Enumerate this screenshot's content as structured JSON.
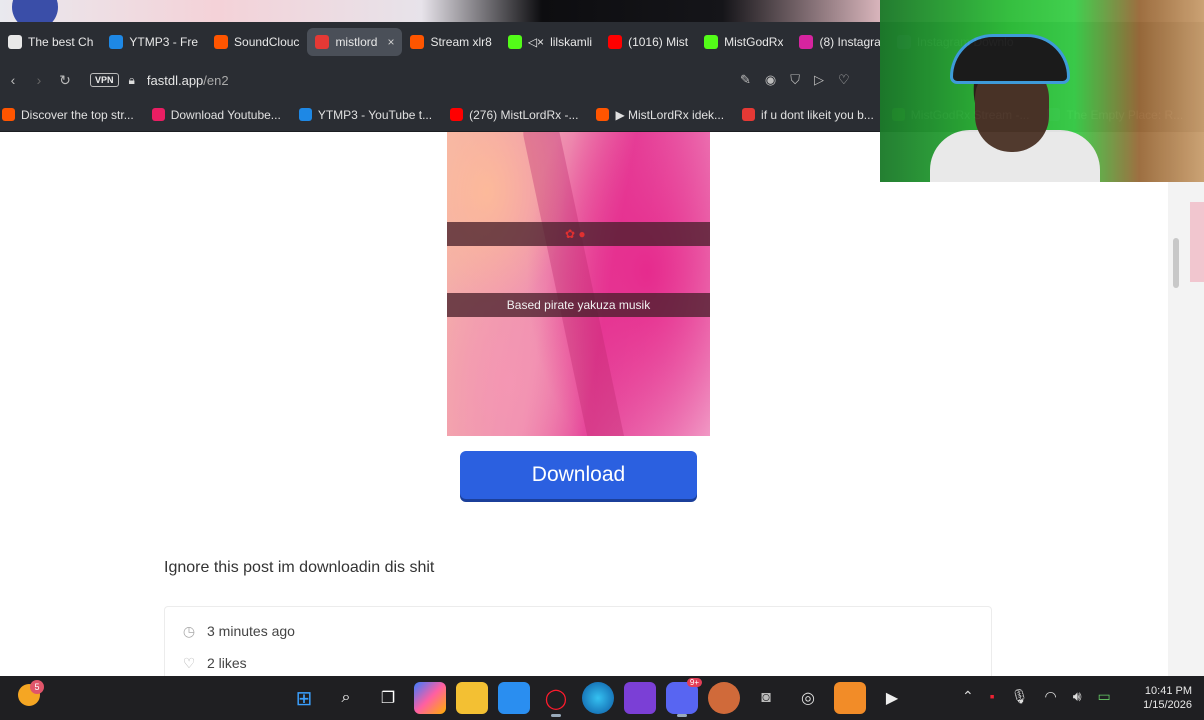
{
  "browser": {
    "tabs": [
      {
        "label": "The best Ch",
        "icon": "diamond-icon",
        "color": "#e8e8e8"
      },
      {
        "label": "YTMP3 - Fre",
        "icon": "ytmp3-icon",
        "color": "#1e88e5"
      },
      {
        "label": "SoundClouc",
        "icon": "soundcloud-icon",
        "color": "#ff5500"
      },
      {
        "label": "mistlord",
        "icon": "power-icon",
        "color": "#e53935",
        "active": true,
        "close": "×"
      },
      {
        "label": "Stream xlr8",
        "icon": "soundcloud-icon",
        "color": "#ff5500"
      },
      {
        "label": "lilskamli",
        "icon": "kick-icon",
        "color": "#53fc18",
        "muted": "◁×"
      },
      {
        "label": "(1016) Mist",
        "icon": "youtube-icon",
        "color": "#ff0000"
      },
      {
        "label": "MistGodRx",
        "icon": "kick-icon",
        "color": "#53fc18"
      },
      {
        "label": "(8) Instagra",
        "icon": "instagram-icon",
        "color": "#d6249f"
      },
      {
        "label": "Instagram Downlo",
        "icon": "download-icon",
        "color": "#7e57c2"
      }
    ],
    "address": {
      "vpn": "VPN",
      "domain": "fastdl.app",
      "path": "/en2"
    },
    "bookmarks": [
      {
        "label": "Discover the top str...",
        "color": "#ff5500"
      },
      {
        "label": "Download Youtube...",
        "color": "#e91e63"
      },
      {
        "label": "YTMP3 - YouTube t...",
        "color": "#1e88e5"
      },
      {
        "label": "(276) MistLordRx -...",
        "color": "#ff0000"
      },
      {
        "label": "▶ MistLordRx idek...",
        "color": "#ff5500"
      },
      {
        "label": "if u dont likeit you b...",
        "color": "#e53935"
      },
      {
        "label": "MistGodRx Stream -...",
        "color": "#53fc18"
      },
      {
        "label": "The Empty Place: R...",
        "color": "#7e57c2"
      }
    ]
  },
  "post": {
    "caption_overlay": "Based pirate yakuza musik",
    "download_label": "Download",
    "text": "Ignore this post im downloadin dis shit",
    "time_ago": "3 minutes ago",
    "likes": "2 likes"
  },
  "taskbar": {
    "weather_badge": "5",
    "discord_badge": "9+",
    "time": "10:41 PM",
    "date": "1/15/2026"
  }
}
